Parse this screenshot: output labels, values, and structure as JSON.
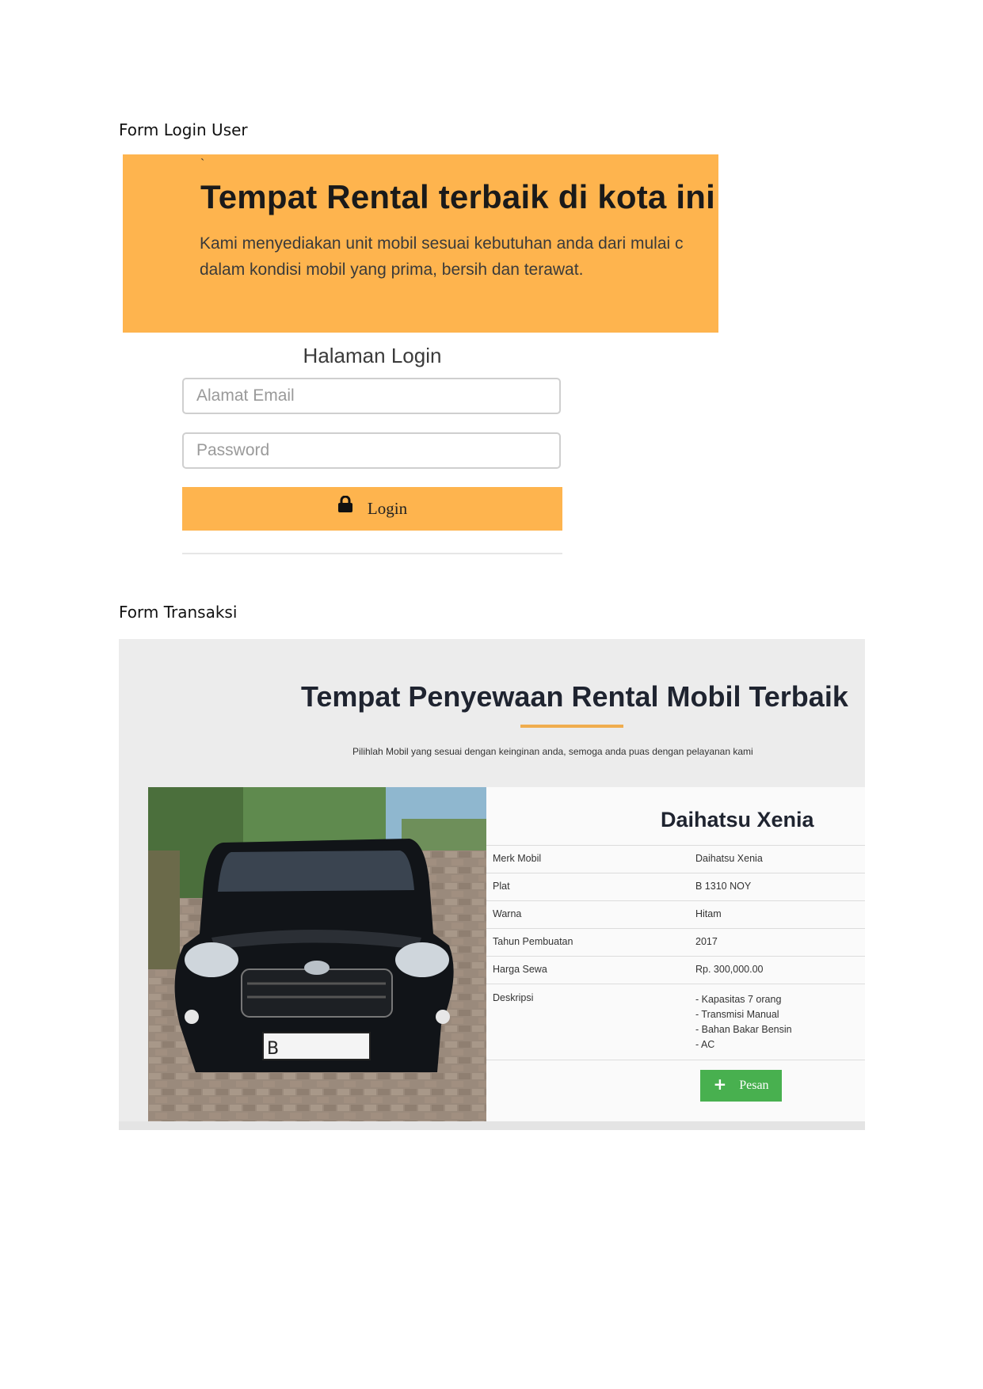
{
  "login_section": {
    "caption": "Form Login User",
    "hero": {
      "tick": "`",
      "title": "Tempat Rental terbaik di kota ini",
      "description_line1": "Kami menyediakan unit mobil sesuai kebutuhan anda dari mulai c",
      "description_line2": "dalam kondisi mobil yang prima, bersih dan terawat."
    },
    "form": {
      "title": "Halaman Login",
      "email_placeholder": "Alamat Email",
      "password_placeholder": "Password",
      "login_label": "Login",
      "login_icon": "lock-icon"
    }
  },
  "transaction_section": {
    "caption": "Form Transaksi",
    "title": "Tempat Penyewaan Rental Mobil Terbaik",
    "subtitle": "Pilihlah Mobil yang sesuai dengan keinginan anda, semoga anda puas dengan pelayanan kami",
    "car": {
      "name": "Daihatsu Xenia",
      "plate_text": "B",
      "specs": [
        {
          "label": "Merk Mobil",
          "value": "Daihatsu Xenia"
        },
        {
          "label": "Plat",
          "value": "B 1310 NOY"
        },
        {
          "label": "Warna",
          "value": "Hitam"
        },
        {
          "label": "Tahun Pembuatan",
          "value": "2017"
        },
        {
          "label": "Harga Sewa",
          "value": "Rp. 300,000.00"
        }
      ],
      "description_label": "Deskripsi",
      "description_lines": [
        "- Kapasitas 7 orang",
        "- Transmisi Manual",
        "- Bahan Bakar Bensin",
        "- AC"
      ]
    },
    "order_button": {
      "label": "Pesan",
      "icon": "plus-icon"
    },
    "colors": {
      "accent_orange": "#feb44e",
      "order_green": "#48b04f",
      "underline": "#f0ad4e"
    }
  }
}
